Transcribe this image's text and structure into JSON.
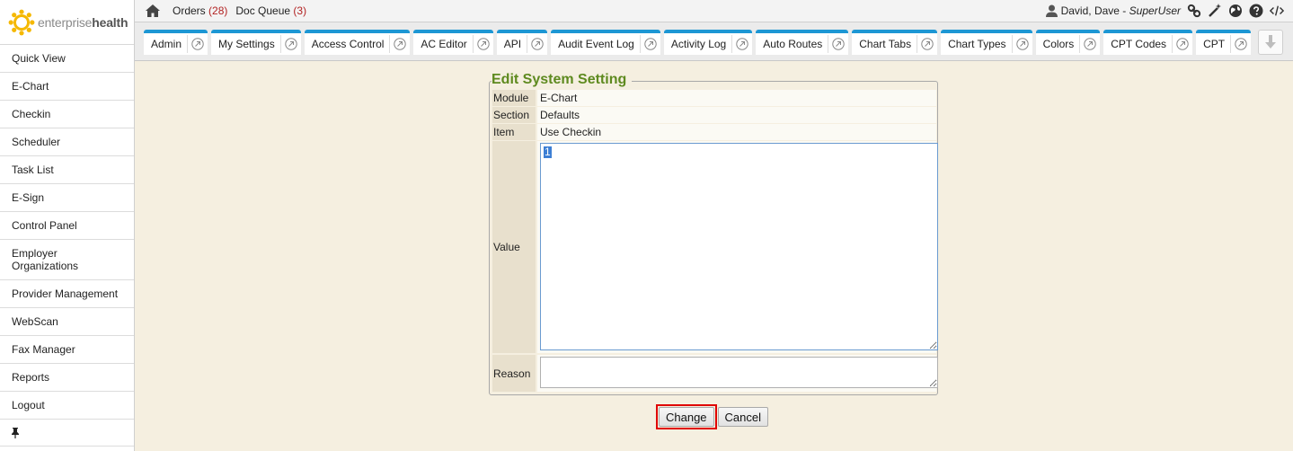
{
  "brand": {
    "logo_light": "enterprise",
    "logo_bold": "health",
    "accent": "#1d97d4",
    "logo_color": "#f5b800"
  },
  "sidebar": {
    "items": [
      {
        "label": "Quick View"
      },
      {
        "label": "E-Chart"
      },
      {
        "label": "Checkin"
      },
      {
        "label": "Scheduler"
      },
      {
        "label": "Task List"
      },
      {
        "label": "E-Sign"
      },
      {
        "label": "Control Panel"
      },
      {
        "label": "Employer Organizations"
      },
      {
        "label": "Provider Management"
      },
      {
        "label": "WebScan"
      },
      {
        "label": "Fax Manager"
      },
      {
        "label": "Reports"
      },
      {
        "label": "Logout"
      }
    ],
    "pin_icon": "pin-icon"
  },
  "topbar": {
    "orders_label": "Orders",
    "orders_count": "(28)",
    "docqueue_label": "Doc Queue",
    "docqueue_count": "(3)",
    "user_name": "David, Dave -",
    "user_role": "SuperUser",
    "icons": [
      "user-icon",
      "link-icon",
      "wand-icon",
      "globe-icon",
      "help-icon",
      "code-icon"
    ]
  },
  "tabs": [
    {
      "label": "Admin"
    },
    {
      "label": "My Settings"
    },
    {
      "label": "Access Control"
    },
    {
      "label": "AC Editor"
    },
    {
      "label": "API"
    },
    {
      "label": "Audit Event Log"
    },
    {
      "label": "Activity Log"
    },
    {
      "label": "Auto Routes"
    },
    {
      "label": "Chart Tabs"
    },
    {
      "label": "Chart Types"
    },
    {
      "label": "Colors"
    },
    {
      "label": "CPT Codes"
    },
    {
      "label": "CPT"
    }
  ],
  "form": {
    "legend": "Edit System Setting",
    "module_label": "Module",
    "module_value": "E-Chart",
    "section_label": "Section",
    "section_value": "Defaults",
    "item_label": "Item",
    "item_value": "Use Checkin",
    "value_label": "Value",
    "value_text": "1",
    "reason_label": "Reason",
    "reason_text": ""
  },
  "buttons": {
    "change": "Change",
    "cancel": "Cancel"
  }
}
